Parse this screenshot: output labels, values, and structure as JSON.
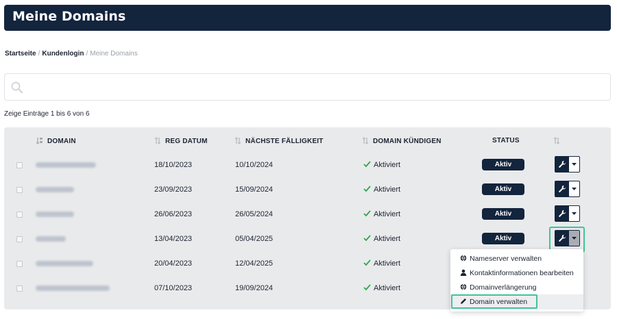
{
  "header": {
    "title": "Meine Domains"
  },
  "breadcrumb": {
    "home": "Startseite",
    "login": "Kundenlogin",
    "current": "Meine Domains",
    "separator": "/"
  },
  "search": {
    "value": "",
    "placeholder": ""
  },
  "table_info": "Zeige Einträge 1 bis 6 von 6",
  "columns": {
    "domain": "DOMAIN",
    "reg_datum": "REG DATUM",
    "faelligkeit": "NÄCHSTE FÄLLIGKEIT",
    "kuendigen": "DOMAIN KÜNDIGEN",
    "status": "STATUS"
  },
  "rows": [
    {
      "reg": "18/10/2023",
      "due": "10/10/2024",
      "cancel": "Aktiviert",
      "status": "Aktiv"
    },
    {
      "reg": "23/09/2023",
      "due": "15/09/2024",
      "cancel": "Aktiviert",
      "status": "Aktiv"
    },
    {
      "reg": "26/06/2023",
      "due": "26/05/2024",
      "cancel": "Aktiviert",
      "status": "Aktiv"
    },
    {
      "reg": "13/04/2023",
      "due": "05/04/2025",
      "cancel": "Aktiviert",
      "status": "Aktiv"
    },
    {
      "reg": "20/04/2023",
      "due": "12/04/2025",
      "cancel": "Aktiviert",
      "status": ""
    },
    {
      "reg": "07/10/2023",
      "due": "19/09/2024",
      "cancel": "Aktiviert",
      "status": ""
    }
  ],
  "dropdown": {
    "items": [
      {
        "label": "Nameserver verwalten",
        "icon": "globe-icon"
      },
      {
        "label": "Kontaktinformationen bearbeiten",
        "icon": "user-icon"
      },
      {
        "label": "Domainverlängerung",
        "icon": "globe-icon"
      },
      {
        "label": "Domain verwalten",
        "icon": "pencil-icon"
      }
    ]
  },
  "colors": {
    "navy": "#13243d",
    "highlight": "#40c497",
    "check": "#2ea84a",
    "table_bg": "#e9eaec"
  }
}
